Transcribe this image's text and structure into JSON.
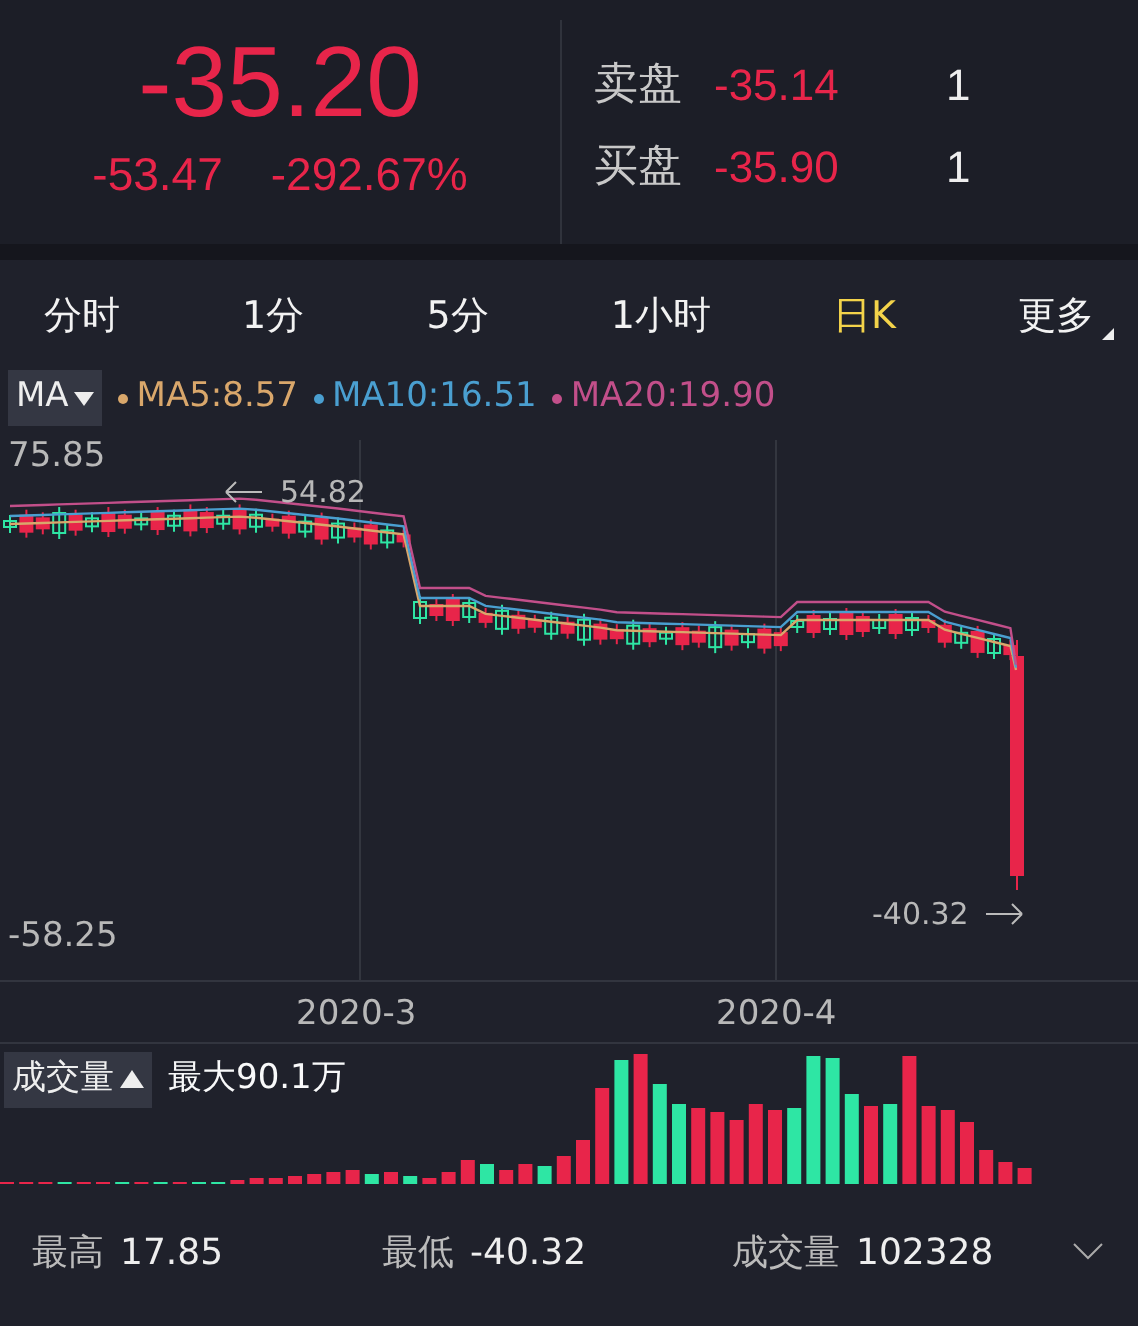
{
  "quote": {
    "price": "-35.20",
    "change": "-53.47",
    "change_pct": "-292.67%"
  },
  "order_book": [
    {
      "label": "卖盘",
      "price": "-35.14",
      "qty": "1"
    },
    {
      "label": "买盘",
      "price": "-35.90",
      "qty": "1"
    }
  ],
  "tabs": [
    {
      "label": "分时",
      "selected": false,
      "kind": "period"
    },
    {
      "label": "1分",
      "selected": false,
      "kind": "period"
    },
    {
      "label": "5分",
      "selected": false,
      "kind": "period"
    },
    {
      "label": "1小时",
      "selected": false,
      "kind": "period"
    },
    {
      "label": "日K",
      "selected": true,
      "kind": "period"
    },
    {
      "label": "更多",
      "selected": false,
      "kind": "menu"
    }
  ],
  "indicator": {
    "selector": "MA",
    "lines": [
      {
        "label": "MA5:8.57",
        "color": "#d9a76b"
      },
      {
        "label": "MA10:16.51",
        "color": "#4a9fd0"
      },
      {
        "label": "MA20:19.90",
        "color": "#c24f8a"
      }
    ]
  },
  "price_chart": {
    "y_max": "75.85",
    "y_min": "-58.25",
    "high_marker": "54.82",
    "low_marker": "-40.32",
    "x_labels": [
      "2020-3",
      "2020-4"
    ]
  },
  "volume": {
    "selector": "成交量",
    "max_label": "最大90.1万"
  },
  "stats": [
    {
      "label": "最高",
      "value": "17.85"
    },
    {
      "label": "最低",
      "value": "-40.32"
    },
    {
      "label": "成交量",
      "value": "102328"
    }
  ]
}
